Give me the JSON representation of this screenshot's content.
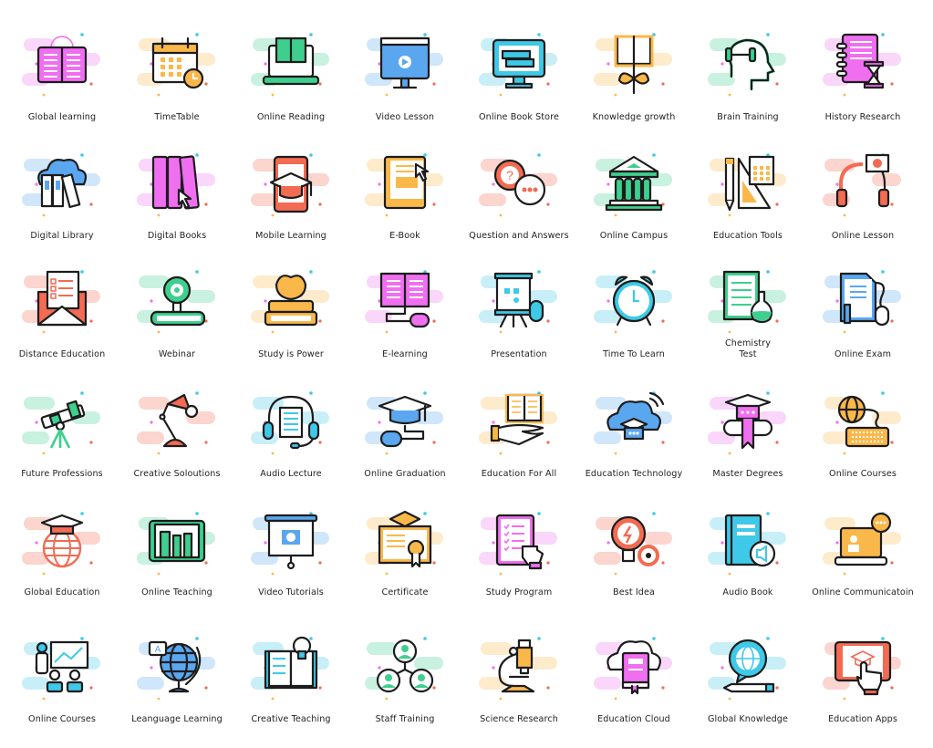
{
  "colors": {
    "pink": "#f06ff0",
    "orange": "#fbb84a",
    "green": "#3ecf8e",
    "blue": "#5aa7f0",
    "cyan": "#3ec9e8",
    "red": "#f26b52",
    "outline": "#1c1c1c",
    "label": "#222222"
  },
  "rows": [
    [
      {
        "label": "Global learning",
        "icon": "open-book-globe-icon",
        "accent": "pink"
      },
      {
        "label": "TimeTable",
        "icon": "calendar-clock-icon",
        "accent": "orange"
      },
      {
        "label": "Online Reading",
        "icon": "laptop-book-icon",
        "accent": "green"
      },
      {
        "label": "Video Lesson",
        "icon": "monitor-play-icon",
        "accent": "blue"
      },
      {
        "label": "Online Book Store",
        "icon": "monitor-books-icon",
        "accent": "cyan"
      },
      {
        "label": "Knowledge growth",
        "icon": "book-plant-icon",
        "accent": "orange"
      },
      {
        "label": "Brain Training",
        "icon": "head-dumbbell-icon",
        "accent": "green"
      },
      {
        "label": "History Research",
        "icon": "notebook-hourglass-icon",
        "accent": "pink"
      }
    ],
    [
      {
        "label": "Digital Library",
        "icon": "cloud-binders-icon",
        "accent": "blue"
      },
      {
        "label": "Digital Books",
        "icon": "books-cursor-icon",
        "accent": "pink"
      },
      {
        "label": "Mobile Learning",
        "icon": "phone-graduation-cap-icon",
        "accent": "red"
      },
      {
        "label": "E-Book",
        "icon": "ebook-cursor-icon",
        "accent": "orange"
      },
      {
        "label": "Question and Answers",
        "icon": "chat-bubbles-question-icon",
        "accent": "red"
      },
      {
        "label": "Online Campus",
        "icon": "university-building-icon",
        "accent": "green"
      },
      {
        "label": "Education Tools",
        "icon": "pencil-ruler-calculator-icon",
        "accent": "orange"
      },
      {
        "label": "Online Lesson",
        "icon": "headphones-video-icon",
        "accent": "red"
      }
    ],
    [
      {
        "label": "Distance Education",
        "icon": "envelope-checklist-icon",
        "accent": "red"
      },
      {
        "label": "Webinar",
        "icon": "webcam-book-icon",
        "accent": "green"
      },
      {
        "label": "Study is Power",
        "icon": "apple-books-icon",
        "accent": "orange"
      },
      {
        "label": "E-learning",
        "icon": "book-mouse-icon",
        "accent": "pink"
      },
      {
        "label": "Presentation",
        "icon": "board-mouse-icon",
        "accent": "cyan"
      },
      {
        "label": "Time To Learn",
        "icon": "alarm-clock-icon",
        "accent": "cyan"
      },
      {
        "label": "Chemistry\nTest",
        "icon": "notepad-flask-icon",
        "accent": "green"
      },
      {
        "label": "Online Exam",
        "icon": "document-mouse-icon",
        "accent": "blue"
      }
    ],
    [
      {
        "label": "Future Professions",
        "icon": "telescope-icon",
        "accent": "green"
      },
      {
        "label": "Creative Soloutions",
        "icon": "desk-lamp-icon",
        "accent": "red"
      },
      {
        "label": "Audio Lecture",
        "icon": "headphones-document-icon",
        "accent": "cyan"
      },
      {
        "label": "Online Graduation",
        "icon": "graduation-cap-mouse-icon",
        "accent": "blue"
      },
      {
        "label": "Education For All",
        "icon": "hand-book-icon",
        "accent": "orange"
      },
      {
        "label": "Education Technology",
        "icon": "cloud-cap-wifi-icon",
        "accent": "blue"
      },
      {
        "label": "Master Degrees",
        "icon": "cap-diploma-icon",
        "accent": "pink"
      },
      {
        "label": "Online Courses",
        "icon": "globe-keyboard-icon",
        "accent": "orange"
      }
    ],
    [
      {
        "label": "Global Education",
        "icon": "globe-cap-icon",
        "accent": "red"
      },
      {
        "label": "Online Teaching",
        "icon": "tablet-tools-icon",
        "accent": "green"
      },
      {
        "label": "Video Tutorials",
        "icon": "projector-screen-play-icon",
        "accent": "blue"
      },
      {
        "label": "Certificate",
        "icon": "certificate-cap-icon",
        "accent": "orange"
      },
      {
        "label": "Study Program",
        "icon": "checklist-hand-icon",
        "accent": "pink"
      },
      {
        "label": "Best Idea",
        "icon": "bulb-target-icon",
        "accent": "red"
      },
      {
        "label": "Audio Book",
        "icon": "book-speaker-icon",
        "accent": "cyan"
      },
      {
        "label": "Online Communicatoin",
        "icon": "laptop-chat-icon",
        "accent": "orange"
      }
    ],
    [
      {
        "label": "Online Courses",
        "icon": "teacher-board-students-icon",
        "accent": "cyan"
      },
      {
        "label": "Leanguage Learning",
        "icon": "globe-stand-letter-icon",
        "accent": "blue"
      },
      {
        "label": "Creative Teaching",
        "icon": "book-bulb-icon",
        "accent": "cyan"
      },
      {
        "label": "Staff Training",
        "icon": "people-network-icon",
        "accent": "green"
      },
      {
        "label": "Science Research",
        "icon": "microscope-icon",
        "accent": "orange"
      },
      {
        "label": "Education Cloud",
        "icon": "cloud-book-icon",
        "accent": "pink"
      },
      {
        "label": "Global Knowledge",
        "icon": "globe-bubble-pencil-icon",
        "accent": "cyan"
      },
      {
        "label": "Education Apps",
        "icon": "tablet-touch-cap-icon",
        "accent": "red"
      }
    ]
  ]
}
